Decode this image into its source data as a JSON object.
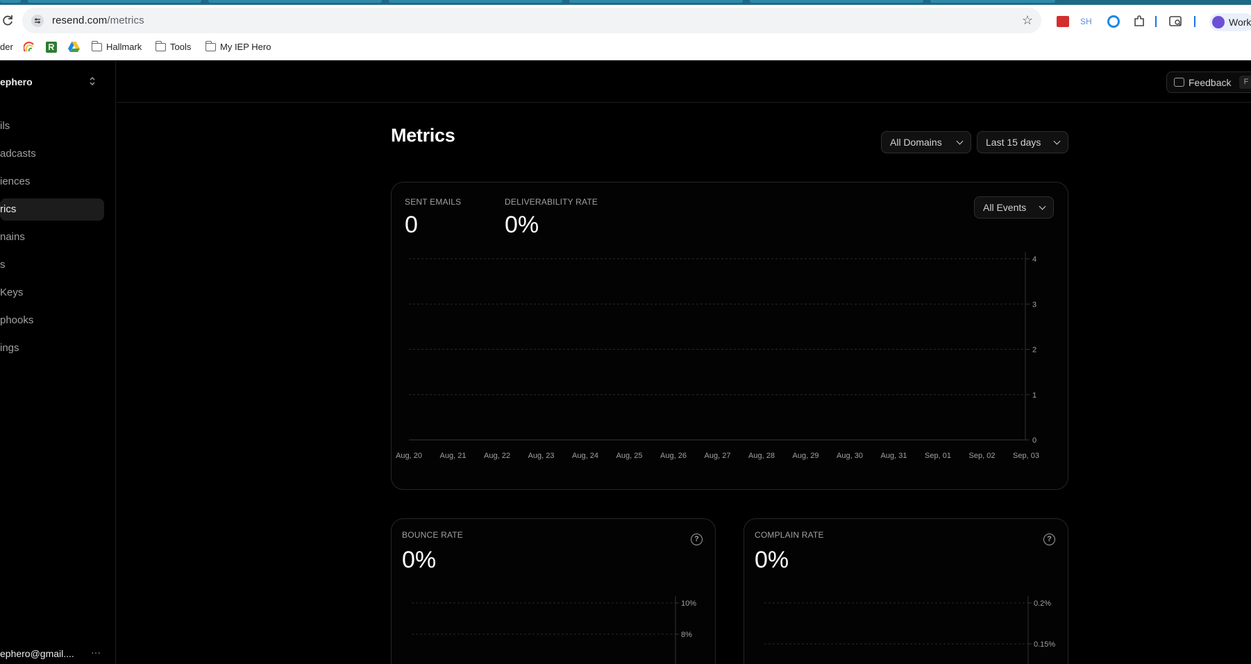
{
  "browser": {
    "url_host": "resend.com",
    "url_path": "/metrics",
    "bookmarks": [
      "der",
      "Hallmark",
      "Tools",
      "My IEP Hero"
    ],
    "extension_sh": "SH",
    "profile_label": "Work"
  },
  "sidebar": {
    "team_name": "ephero",
    "items": [
      {
        "label": "ils"
      },
      {
        "label": "adcasts"
      },
      {
        "label": "iences"
      },
      {
        "label": "rics",
        "active": true
      },
      {
        "label": "nains"
      },
      {
        "label": "s"
      },
      {
        "label": "Keys"
      },
      {
        "label": "phooks"
      },
      {
        "label": "ings"
      }
    ],
    "account_email": "ephero@gmail....",
    "account_more": "···"
  },
  "header": {
    "feedback_label": "Feedback",
    "feedback_shortcut": "F"
  },
  "main": {
    "title": "Metrics",
    "domain_filter": "All Domains",
    "range_filter": "Last 15 days"
  },
  "overview": {
    "sent_label": "SENT EMAILS",
    "sent_value": "0",
    "deliverability_label": "DELIVERABILITY RATE",
    "deliverability_value": "0%",
    "events_filter": "All Events"
  },
  "bounce": {
    "label": "BOUNCE RATE",
    "value": "0%"
  },
  "complain": {
    "label": "COMPLAIN RATE",
    "value": "0%"
  },
  "chart_data": [
    {
      "type": "line",
      "title": "",
      "x": [
        "Aug, 20",
        "Aug, 21",
        "Aug, 22",
        "Aug, 23",
        "Aug, 24",
        "Aug, 25",
        "Aug, 26",
        "Aug, 27",
        "Aug, 28",
        "Aug, 29",
        "Aug, 30",
        "Aug, 31",
        "Sep, 01",
        "Sep, 02",
        "Sep, 03"
      ],
      "series": [
        {
          "values": [
            0,
            0,
            0,
            0,
            0,
            0,
            0,
            0,
            0,
            0,
            0,
            0,
            0,
            0,
            0
          ]
        }
      ],
      "ylim": [
        0,
        4
      ],
      "yticks": [
        "0",
        "1",
        "2",
        "3",
        "4"
      ],
      "y_axis_side": "right",
      "grid": true
    },
    {
      "type": "line",
      "title": "",
      "yticks_visible": [
        "10%",
        "8%"
      ],
      "y_axis_side": "right",
      "grid": true
    },
    {
      "type": "line",
      "title": "",
      "yticks_visible": [
        "0.2%",
        "0.15%"
      ],
      "y_axis_side": "right",
      "grid": true
    }
  ]
}
